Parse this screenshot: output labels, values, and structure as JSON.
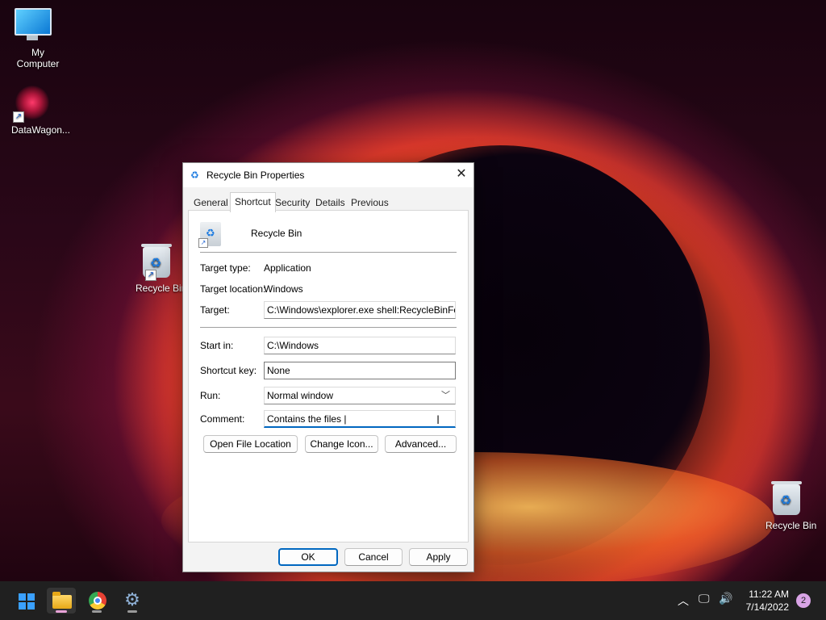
{
  "desktop": {
    "icons": [
      {
        "label": "My Computer"
      },
      {
        "label": "DataWagon..."
      },
      {
        "label": "Recycle Bin"
      },
      {
        "label": "Recycle Bin"
      }
    ]
  },
  "dialog": {
    "title": "Recycle Bin Properties",
    "tabs": [
      "General",
      "Shortcut",
      "Security",
      "Details",
      "Previous Versions"
    ],
    "active_tab": "Shortcut",
    "name": "Recycle Bin",
    "target_type_label": "Target type:",
    "target_type_value": "Application",
    "target_location_label": "Target location:",
    "target_location_value": "Windows",
    "target_label": "Target:",
    "target_value": "C:\\Windows\\explorer.exe shell:RecycleBinFolder",
    "start_in_label": "Start in:",
    "start_in_value": "C:\\Windows",
    "shortcut_key_label": "Shortcut key:",
    "shortcut_key_value": "None",
    "run_label": "Run:",
    "run_value": "Normal window",
    "comment_label": "Comment:",
    "comment_value": "Contains the files |",
    "buttons": {
      "open_file_location": "Open File Location",
      "change_icon": "Change Icon...",
      "advanced": "Advanced...",
      "ok": "OK",
      "cancel": "Cancel",
      "apply": "Apply"
    }
  },
  "taskbar": {
    "apps": [
      "start-icon",
      "file-explorer-icon",
      "chrome-icon",
      "settings-icon"
    ],
    "time": "11:22 AM",
    "date": "7/14/2022",
    "notification_count": "2",
    "accent_color": "#0067c0"
  }
}
